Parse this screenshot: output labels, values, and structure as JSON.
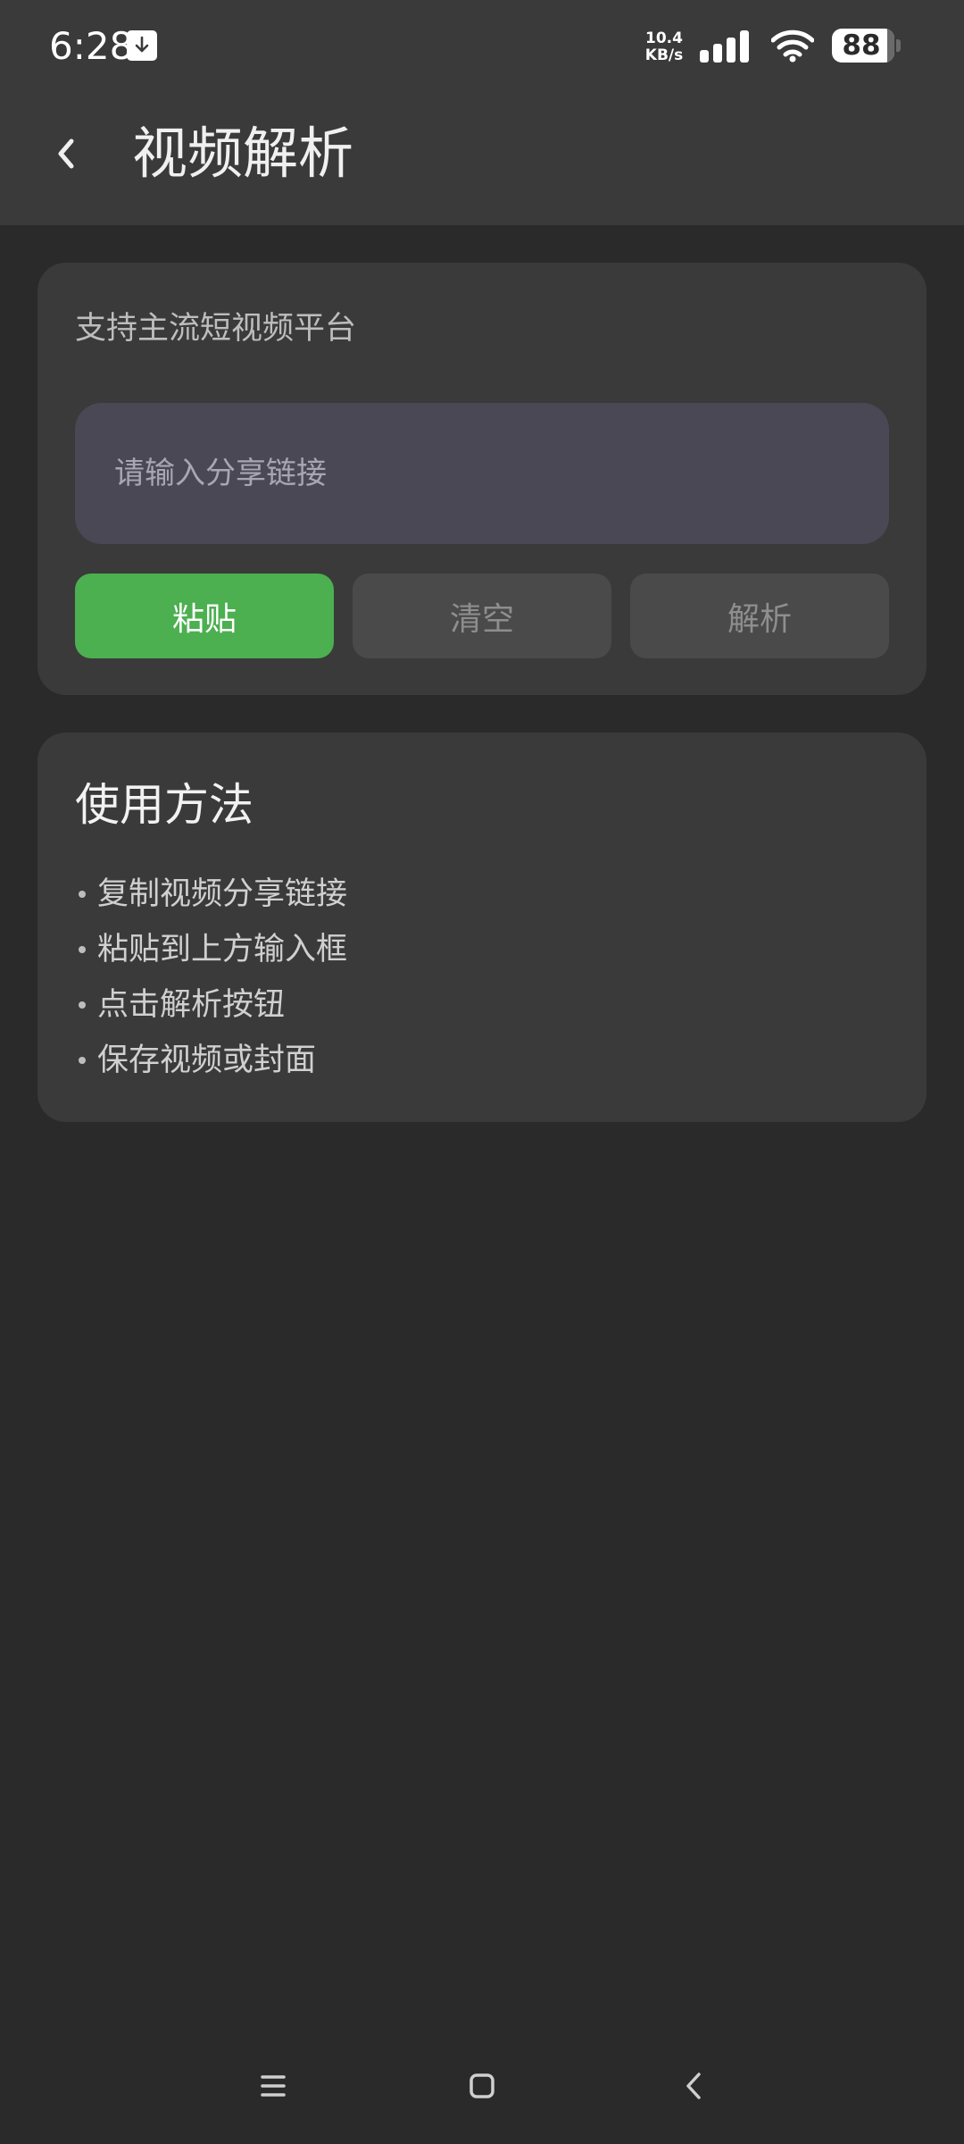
{
  "status_bar": {
    "time": "6:28",
    "net_speed_value": "10.4",
    "net_speed_unit": "KB/s",
    "battery": "88",
    "icons": [
      "download-notification-icon",
      "signal-icon",
      "wifi-icon",
      "battery-icon"
    ]
  },
  "app_bar": {
    "title": "视频解析",
    "back_icon": "chevron-left-icon"
  },
  "input_card": {
    "subtitle": "支持主流短视频平台",
    "url_input": {
      "value": "",
      "placeholder": "请输入分享链接"
    },
    "buttons": {
      "paste": "粘贴",
      "clear": "清空",
      "parse": "解析"
    }
  },
  "help_card": {
    "title": "使用方法",
    "steps": [
      "复制视频分享链接",
      "粘贴到上方输入框",
      "点击解析按钮",
      "保存视频或封面"
    ]
  },
  "nav_bar": {
    "icons": [
      "menu-icon",
      "home-icon",
      "back-icon"
    ]
  },
  "colors": {
    "background": "#2a2a2a",
    "header": "#3a3a3a",
    "card": "#3a3a3a",
    "input": "#4a4855",
    "accent": "#4caf50",
    "disabled_button": "#4a4a4a"
  }
}
